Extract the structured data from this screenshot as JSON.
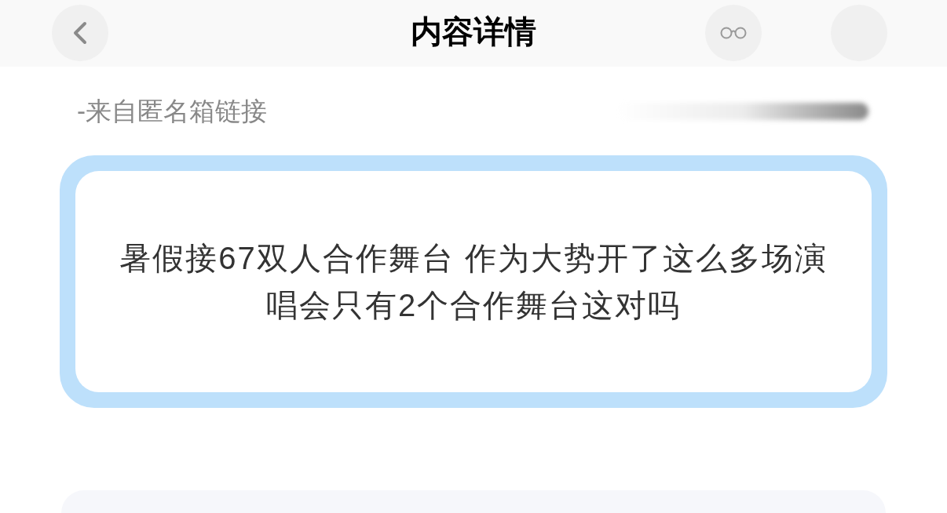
{
  "header": {
    "title": "内容详情"
  },
  "source": {
    "label": "-来自匿名箱链接"
  },
  "message": {
    "text": "暑假接67双人合作舞台 作为大势开了这么多场演唱会只有2个合作舞台这对吗"
  }
}
